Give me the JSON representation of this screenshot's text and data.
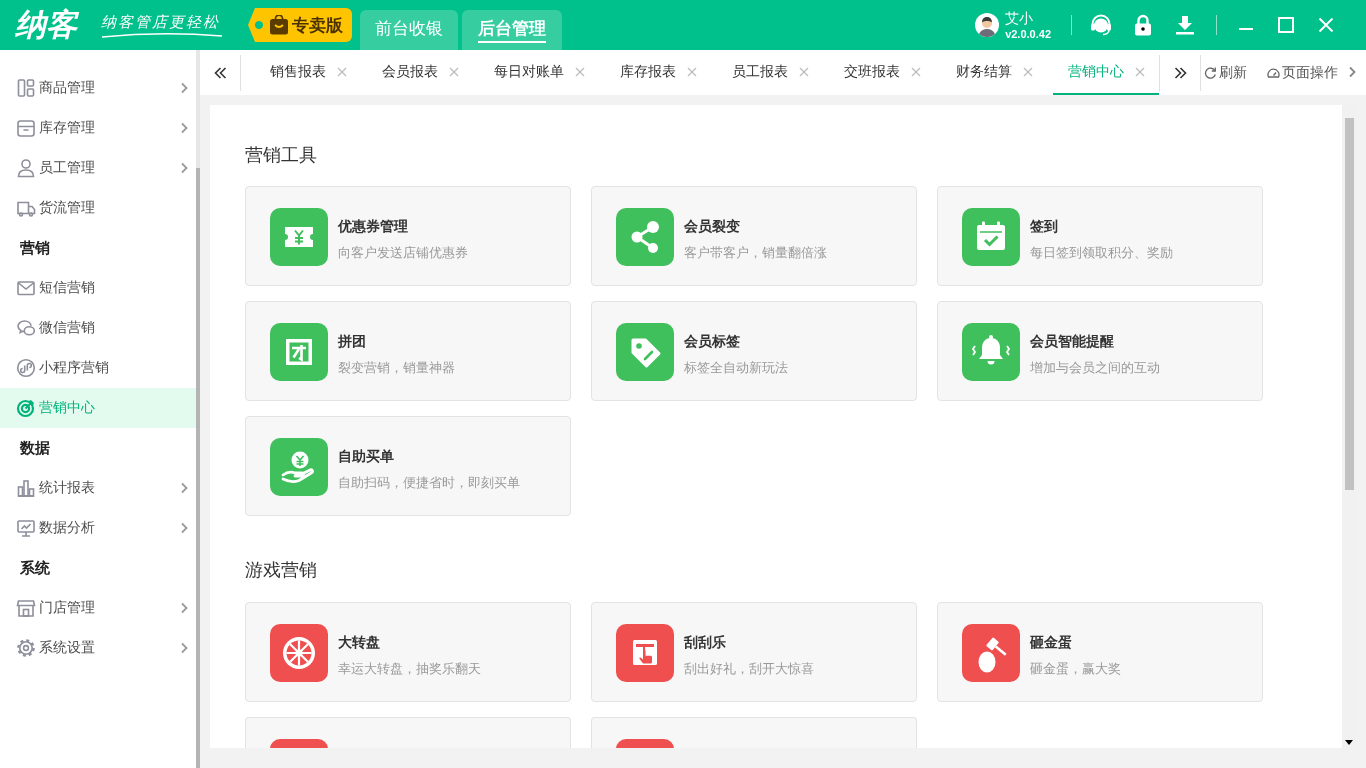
{
  "topbar": {
    "logo": "纳客",
    "slogan": "纳客管店更轻松",
    "edition": "专卖版",
    "nav_tabs": [
      {
        "label": "前台收银",
        "selected": false
      },
      {
        "label": "后台管理",
        "selected": true
      }
    ],
    "user": {
      "name": "艾小",
      "version": "v2.0.0.42"
    }
  },
  "sidebar": {
    "groups": [
      {
        "items": [
          {
            "kind": "goods",
            "label": "商品管理",
            "expandable": true,
            "selected": false
          },
          {
            "kind": "stock",
            "label": "库存管理",
            "expandable": true,
            "selected": false
          },
          {
            "kind": "staff",
            "label": "员工管理",
            "expandable": true,
            "selected": false
          },
          {
            "kind": "logistics",
            "label": "货流管理",
            "expandable": false,
            "selected": false
          }
        ]
      },
      {
        "title": "营销",
        "items": [
          {
            "kind": "sms",
            "label": "短信营销",
            "expandable": false,
            "selected": false
          },
          {
            "kind": "wechat",
            "label": "微信营销",
            "expandable": false,
            "selected": false
          },
          {
            "kind": "miniapp",
            "label": "小程序营销",
            "expandable": false,
            "selected": false
          },
          {
            "kind": "center",
            "label": "营销中心",
            "expandable": false,
            "selected": true
          }
        ]
      },
      {
        "title": "数据",
        "items": [
          {
            "kind": "stats",
            "label": "统计报表",
            "expandable": true,
            "selected": false
          },
          {
            "kind": "analysis",
            "label": "数据分析",
            "expandable": true,
            "selected": false
          }
        ]
      },
      {
        "title": "系统",
        "items": [
          {
            "kind": "store",
            "label": "门店管理",
            "expandable": true,
            "selected": false
          },
          {
            "kind": "settings",
            "label": "系统设置",
            "expandable": true,
            "selected": false
          }
        ]
      }
    ]
  },
  "tabs": [
    {
      "label": "销售报表",
      "selected": false
    },
    {
      "label": "会员报表",
      "selected": false
    },
    {
      "label": "每日对账单",
      "selected": false
    },
    {
      "label": "库存报表",
      "selected": false
    },
    {
      "label": "员工报表",
      "selected": false
    },
    {
      "label": "交班报表",
      "selected": false
    },
    {
      "label": "财务结算",
      "selected": false
    },
    {
      "label": "营销中心",
      "selected": true
    }
  ],
  "tab_actions": [
    {
      "kind": "refresh",
      "label": "刷新"
    },
    {
      "kind": "operations",
      "label": "页面操作"
    }
  ],
  "sections": [
    {
      "kind": "tools",
      "title": "营销工具",
      "cards": [
        {
          "kind": "coupon",
          "title": "优惠券管理",
          "description": "向客户发送店铺优惠券"
        },
        {
          "kind": "referral",
          "title": "会员裂变",
          "description": "客户带客户，销量翻倍涨"
        },
        {
          "kind": "checkin",
          "title": "签到",
          "description": "每日签到领取积分、奖励"
        },
        {
          "kind": "groupbuy",
          "title": "拼团",
          "description": "裂变营销，销量神器"
        },
        {
          "kind": "label",
          "title": "会员标签",
          "description": "标签全自动新玩法"
        },
        {
          "kind": "reminder",
          "title": "会员智能提醒",
          "description": "增加与会员之间的互动"
        },
        {
          "kind": "selfpay",
          "title": "自助买单",
          "description": "自助扫码，便捷省时，即刻买单"
        }
      ]
    },
    {
      "kind": "games",
      "title": "游戏营销",
      "cards": [
        {
          "kind": "wheel",
          "title": "大转盘",
          "description": "幸运大转盘，抽奖乐翻天"
        },
        {
          "kind": "scratch",
          "title": "刮刮乐",
          "description": "刮出好礼，刮开大惊喜"
        },
        {
          "kind": "egg",
          "title": "砸金蛋",
          "description": "砸金蛋，赢大奖"
        },
        {
          "kind": "partial"
        },
        {
          "kind": "partial"
        }
      ]
    }
  ]
}
